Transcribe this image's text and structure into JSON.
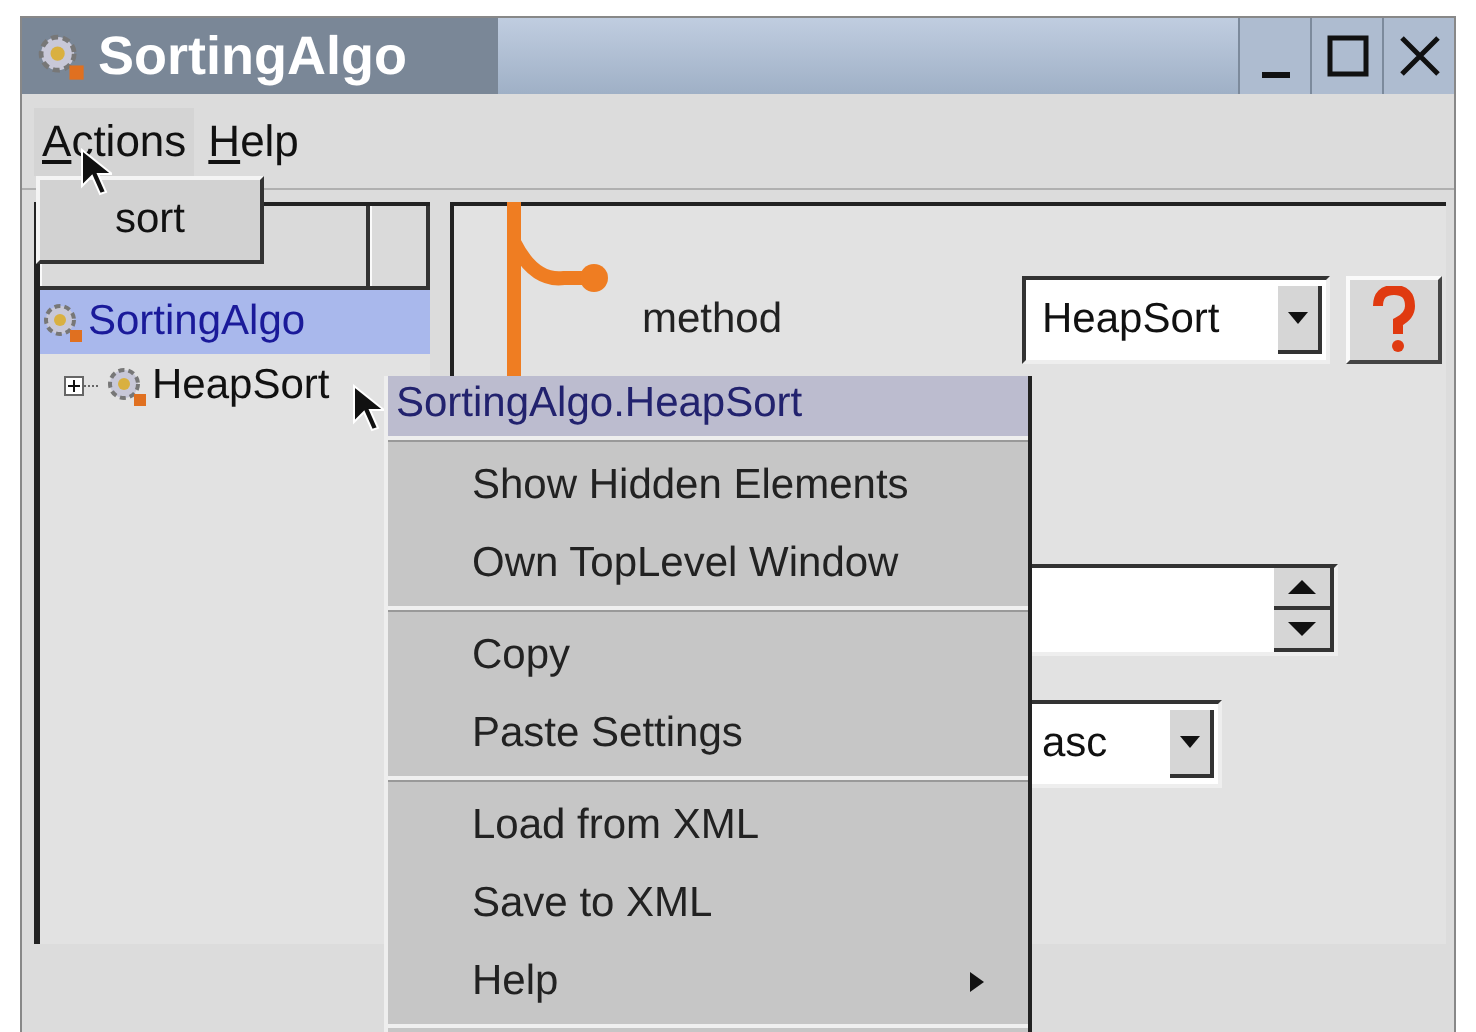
{
  "window": {
    "title": "SortingAlgo"
  },
  "menubar": [
    {
      "label": "Actions",
      "open": true
    },
    {
      "label": "Help",
      "open": false
    }
  ],
  "actions_menu": {
    "items": [
      "sort"
    ]
  },
  "tree": {
    "items": [
      {
        "label": "SortingAlgo",
        "selected": true,
        "children": [
          {
            "label": "HeapSort",
            "selected": false,
            "expanded": false
          }
        ]
      }
    ]
  },
  "properties": [
    {
      "kind": "combo",
      "label": "method",
      "value": "HeapSort",
      "help": true
    },
    {
      "kind": "spinner"
    },
    {
      "kind": "combo",
      "value": "asc"
    }
  ],
  "context_menu": {
    "title": "SortingAlgo.HeapSort",
    "groups": [
      [
        {
          "label": "Show Hidden Elements",
          "submenu": false
        },
        {
          "label": "Own TopLevel Window",
          "submenu": false
        }
      ],
      [
        {
          "label": "Copy",
          "submenu": false
        },
        {
          "label": "Paste Settings",
          "submenu": false
        }
      ],
      [
        {
          "label": "Load from XML",
          "submenu": false
        },
        {
          "label": "Save to XML",
          "submenu": false
        },
        {
          "label": "Help",
          "submenu": true
        }
      ]
    ]
  }
}
